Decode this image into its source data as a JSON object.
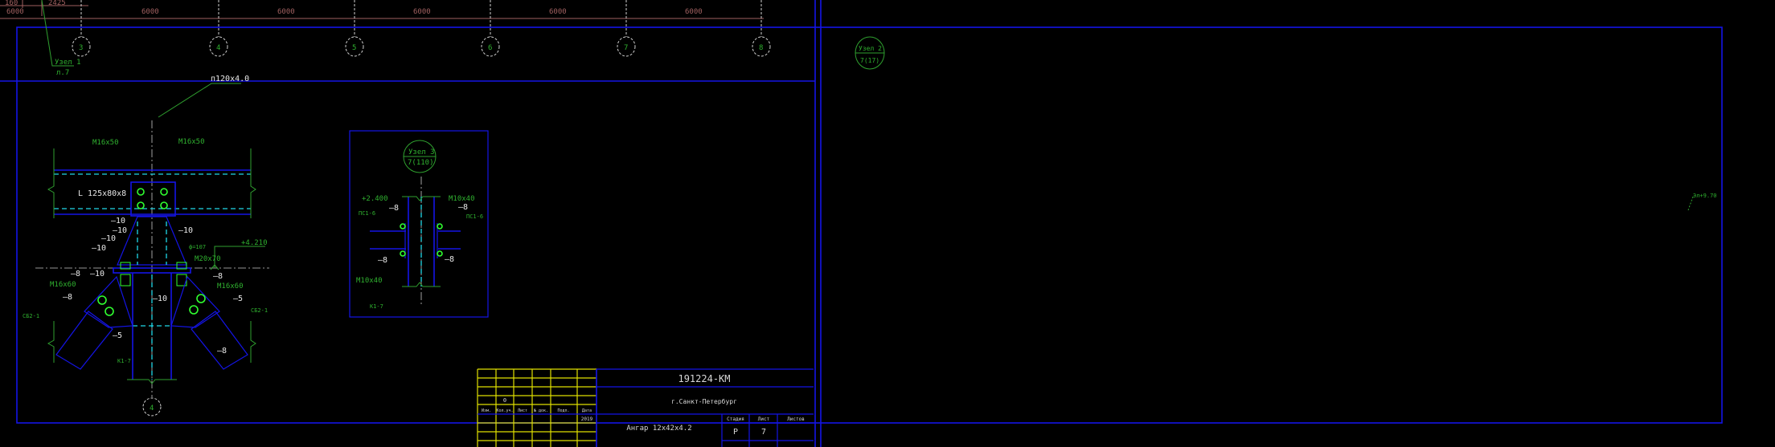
{
  "top_plan": {
    "dims": [
      "160",
      "2425",
      "6000",
      "6000",
      "6000",
      "6000",
      "6000",
      "6000"
    ],
    "axes": [
      "3",
      "4",
      "5",
      "6",
      "7",
      "8"
    ],
    "node1_callout": {
      "title": "Узел 1",
      "sheet": "л.7"
    },
    "profile_label": "п120х4.0"
  },
  "node1": {
    "labels": [
      "М16х50",
      "М16х50",
      "L 125х80х8",
      "—10",
      "—10",
      "—10",
      "—10",
      "—10",
      "+4.210",
      "М20х70",
      "ф=107",
      "—8",
      "—10",
      "М16х60",
      "—8",
      "СБ2-1",
      "—5",
      "К1-7",
      "—10",
      "—8",
      "М16х60",
      "—5",
      "СБ2-1",
      "—8"
    ],
    "axis": "4"
  },
  "node3": {
    "title": "Узел 3",
    "ref": "7(110)",
    "labels": [
      "+2.400",
      "ПС1-6",
      "—8",
      "—8",
      "М10х40",
      "К1-7",
      "М10х40",
      "—8",
      "ПС1-6",
      "—8"
    ]
  },
  "node2": {
    "title": "Узел 2",
    "ref": "7(17)",
    "note": "Эл+9.70"
  },
  "title_block": {
    "code": "191224-КМ",
    "city": "г.Санкт-Петербург",
    "object": "Ангар 12х42х4.2",
    "revision_value": "0",
    "year": "2019",
    "headers": [
      "Изм.",
      "Кол.уч.",
      "Лист",
      "№ док.",
      "Подп.",
      "Дата"
    ],
    "stage_label": "Стадия",
    "sheet_label": "Лист",
    "sheets_label": "Листов",
    "stage": "Р",
    "sheet": "7"
  }
}
